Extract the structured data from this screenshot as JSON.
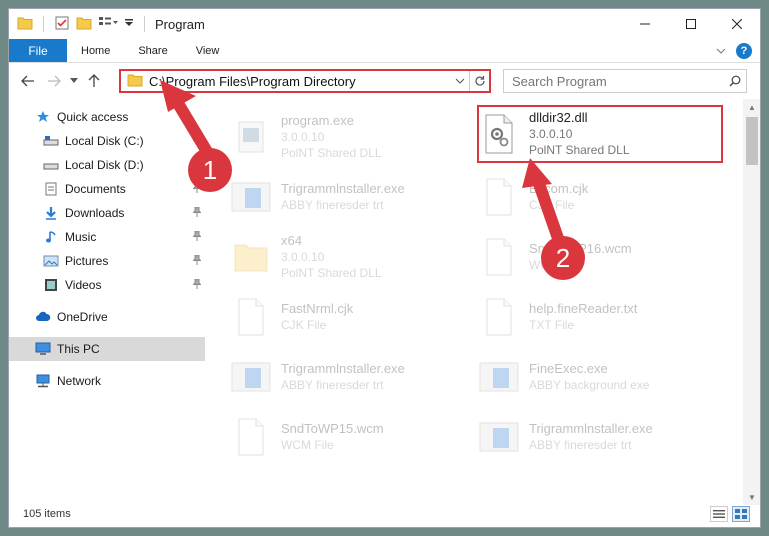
{
  "window": {
    "title": "Program"
  },
  "ribbon": {
    "file": "File",
    "tabs": [
      "Home",
      "Share",
      "View"
    ],
    "help": "?"
  },
  "address": {
    "path": "C:\\Program Files\\Program Directory"
  },
  "search": {
    "placeholder": "Search Program"
  },
  "sidebar": {
    "items": [
      {
        "label": "Quick access",
        "icon": "star-icon",
        "pinned": false
      },
      {
        "label": "Local Disk (C:)",
        "icon": "drive-icon",
        "pinned": true
      },
      {
        "label": "Local Disk (D:)",
        "icon": "drive-icon",
        "pinned": true
      },
      {
        "label": "Documents",
        "icon": "documents-icon",
        "pinned": true
      },
      {
        "label": "Downloads",
        "icon": "downloads-icon",
        "pinned": true
      },
      {
        "label": "Music",
        "icon": "music-icon",
        "pinned": true
      },
      {
        "label": "Pictures",
        "icon": "pictures-icon",
        "pinned": true
      },
      {
        "label": "Videos",
        "icon": "videos-icon",
        "pinned": true
      },
      {
        "label": "OneDrive",
        "icon": "cloud-icon",
        "pinned": false
      },
      {
        "label": "This PC",
        "icon": "computer-icon",
        "pinned": false,
        "selected": true
      },
      {
        "label": "Network",
        "icon": "network-icon",
        "pinned": false
      }
    ]
  },
  "files": [
    {
      "name": "program.exe",
      "line1": "3.0.0.10",
      "line2": "PolNT Shared DLL",
      "icon": "exe-icon",
      "faded": true
    },
    {
      "name": "dlldir32.dll",
      "line1": "3.0.0.10",
      "line2": "PolNT Shared DLL",
      "icon": "dll-gear-icon",
      "faded": false,
      "highlighted": true
    },
    {
      "name": "Trigrammlnstaller.exe",
      "line1": "ABBY fineresder trt",
      "line2": "",
      "icon": "installer-icon",
      "faded": true
    },
    {
      "name": "Bscom.cjk",
      "line1": "CJK File",
      "line2": "",
      "icon": "blank-file-icon",
      "faded": true
    },
    {
      "name": "x64",
      "line1": "3.0.0.10",
      "line2": "PolNT Shared DLL",
      "icon": "folder-icon",
      "faded": true
    },
    {
      "name": "SndToWP16.wcm",
      "line1": "WCM File",
      "line2": "",
      "icon": "blank-file-icon",
      "faded": true
    },
    {
      "name": "FastNrml.cjk",
      "line1": "CJK File",
      "line2": "",
      "icon": "blank-file-icon",
      "faded": true
    },
    {
      "name": "help.fineReader.txt",
      "line1": "TXT File",
      "line2": "",
      "icon": "blank-file-icon",
      "faded": true
    },
    {
      "name": "Trigrammlnstaller.exe",
      "line1": "ABBY fineresder trt",
      "line2": "",
      "icon": "installer-icon",
      "faded": true
    },
    {
      "name": "FineExec.exe",
      "line1": "ABBY background exe",
      "line2": "",
      "icon": "installer-icon",
      "faded": true
    },
    {
      "name": "SndToWP15.wcm",
      "line1": "WCM File",
      "line2": "",
      "icon": "blank-file-icon",
      "faded": true
    },
    {
      "name": "Trigrammlnstaller.exe",
      "line1": "ABBY fineresder trt",
      "line2": "",
      "icon": "installer-icon",
      "faded": true
    }
  ],
  "status": {
    "count": "105 items"
  },
  "annotations": {
    "badge1": "1",
    "badge2": "2"
  },
  "colors": {
    "accent": "#1979ca",
    "highlight": "#d9363e",
    "selected": "#d9d9d9"
  }
}
